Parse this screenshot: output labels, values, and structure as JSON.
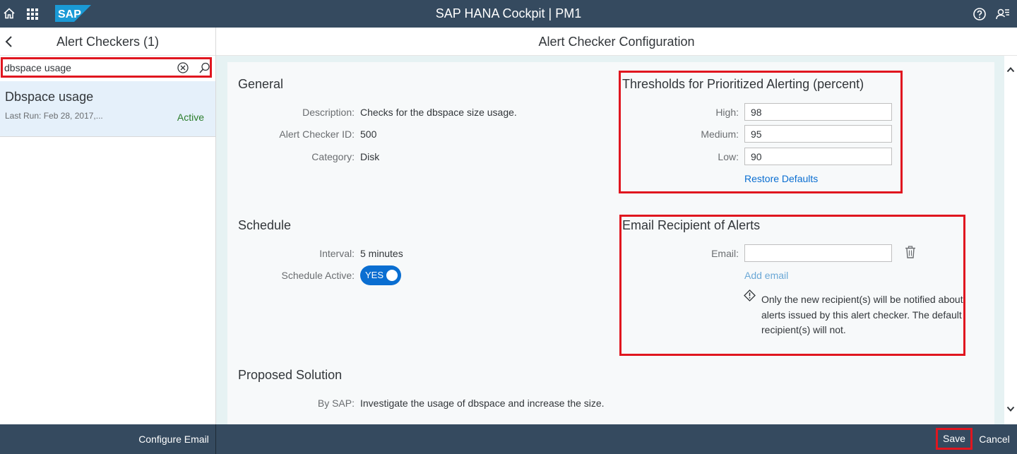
{
  "shell": {
    "title": "SAP HANA Cockpit | PM1",
    "logo_text": "SAP",
    "icons": [
      "home-icon",
      "app-grid-icon",
      "help-icon",
      "user-settings-icon"
    ]
  },
  "master": {
    "title": "Alert Checkers (1)",
    "search": {
      "value": "dbspace usage"
    },
    "items": [
      {
        "name": "Dbspace usage",
        "last_run": "Last Run: Feb 28, 2017,...",
        "status": "Active"
      }
    ]
  },
  "detail": {
    "title": "Alert Checker Configuration",
    "general": {
      "title": "General",
      "description_label": "Description:",
      "description": "Checks for the dbspace size usage.",
      "id_label": "Alert Checker ID:",
      "id": "500",
      "category_label": "Category:",
      "category": "Disk"
    },
    "thresholds": {
      "title": "Thresholds for Prioritized Alerting (percent)",
      "high_label": "High:",
      "high": "98",
      "medium_label": "Medium:",
      "medium": "95",
      "low_label": "Low:",
      "low": "90",
      "restore": "Restore Defaults"
    },
    "schedule": {
      "title": "Schedule",
      "interval_label": "Interval:",
      "interval": "5 minutes",
      "active_label": "Schedule Active:",
      "toggle": "YES"
    },
    "email": {
      "title": "Email Recipient of Alerts",
      "email_label": "Email:",
      "email_value": "",
      "add": "Add email",
      "note": "Only the new recipient(s) will be notified about alerts issued by this alert checker. The default recipient(s) will not."
    },
    "solution": {
      "title": "Proposed Solution",
      "by_label": "By SAP:",
      "text": "Investigate the usage of dbspace and increase the size."
    }
  },
  "footer": {
    "configure_email": "Configure Email",
    "save": "Save",
    "cancel": "Cancel"
  },
  "colors": {
    "shell": "#354a5f",
    "accent": "#0a6ed1",
    "highlight_box": "#e0161f",
    "status_active": "#2b7d2b",
    "selected_item": "#e5f0fa"
  }
}
